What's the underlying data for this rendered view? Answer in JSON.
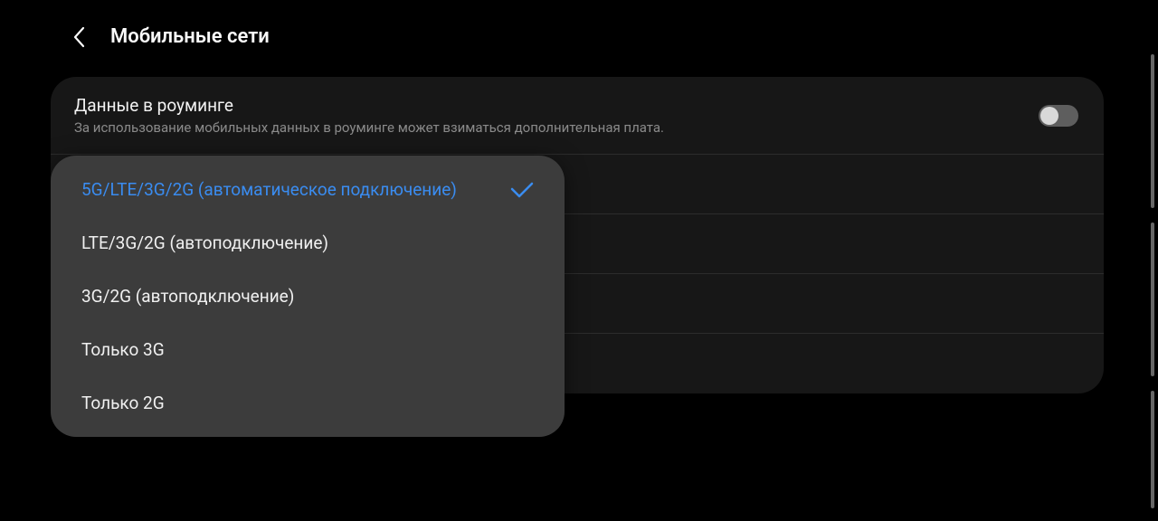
{
  "header": {
    "title": "Мобильные сети"
  },
  "roaming": {
    "title": "Данные в роуминге",
    "desc": "За использование мобильных данных в роуминге может взиматься дополнительная плата."
  },
  "popup": {
    "items": [
      {
        "label": "5G/LTE/3G/2G (автоматическое подключение)",
        "selected": true
      },
      {
        "label": "LTE/3G/2G (автоподключение)",
        "selected": false
      },
      {
        "label": "3G/2G (автоподключение)",
        "selected": false
      },
      {
        "label": "Только 3G",
        "selected": false
      },
      {
        "label": "Только 2G",
        "selected": false
      }
    ]
  }
}
